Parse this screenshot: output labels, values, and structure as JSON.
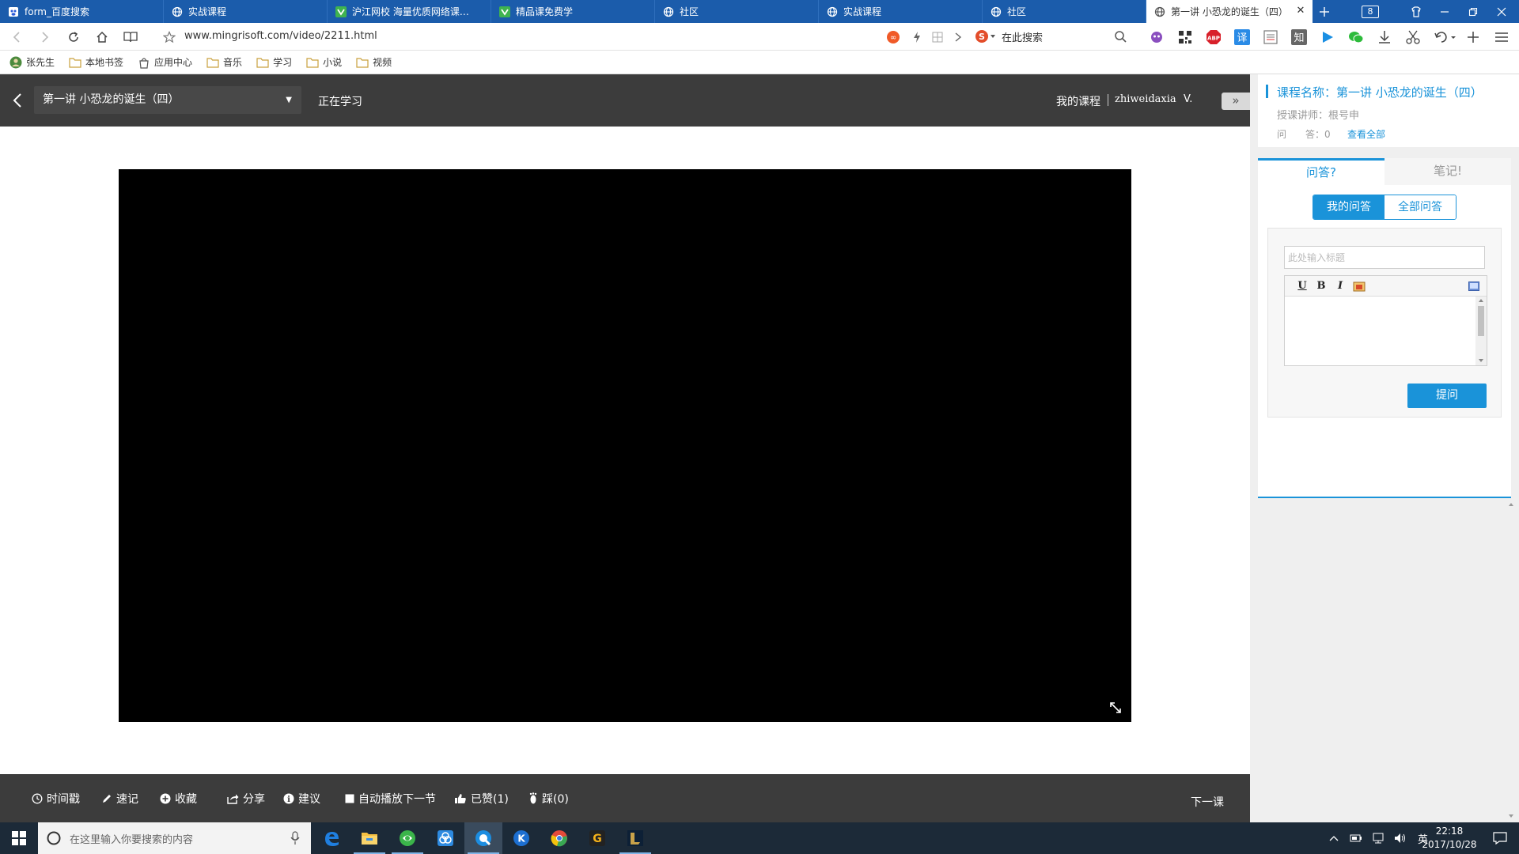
{
  "browser": {
    "tabs": [
      {
        "title": "form_百度搜索",
        "icon": "baidu-icon"
      },
      {
        "title": "实战课程",
        "icon": "globe-icon"
      },
      {
        "title": "沪江网校 海量优质网络课程在线学习",
        "icon": "hujiang-icon"
      },
      {
        "title": "精品课免费学",
        "icon": "hujiang-icon"
      },
      {
        "title": "社区",
        "icon": "globe-icon"
      },
      {
        "title": "实战课程",
        "icon": "globe-icon"
      },
      {
        "title": "社区",
        "icon": "globe-icon"
      },
      {
        "title": "第一讲 小恐龙的诞生（四）",
        "icon": "globe-icon",
        "active": true
      }
    ],
    "tab_count": "8",
    "url": "www.mingrisoft.com/video/2211.html",
    "search_placeholder": "在此搜索",
    "bookmarks": [
      {
        "label": "张先生",
        "icon": "user-avatar-icon"
      },
      {
        "label": "本地书签",
        "icon": "folder-icon"
      },
      {
        "label": "应用中心",
        "icon": "app-icon"
      },
      {
        "label": "音乐",
        "icon": "folder-icon"
      },
      {
        "label": "学习",
        "icon": "folder-icon"
      },
      {
        "label": "小说",
        "icon": "folder-icon"
      },
      {
        "label": "视频",
        "icon": "folder-icon"
      }
    ],
    "extensions": {
      "translate": "译",
      "zhihu": "知",
      "abp": "ABP"
    }
  },
  "page": {
    "lesson_select": "第一讲 小恐龙的诞生（四）",
    "status": "正在学习",
    "my_courses": "我的课程",
    "username": "zhiweidaxia",
    "vip_mark": "V."
  },
  "toolbar": {
    "timestamp": "时间戳",
    "note": "速记",
    "favorite": "收藏",
    "share": "分享",
    "suggest": "建议",
    "autoplay": "自动播放下一节",
    "liked": "已赞(1)",
    "dislike": "踩(0)",
    "next_lesson": "下一课"
  },
  "panel": {
    "course_name": "课程名称：第一讲 小恐龙的诞生（四）",
    "teacher": "授课讲师：根号申",
    "qa_count": "问　　答：0",
    "view_all": "查看全部",
    "tab_qa": "问答?",
    "tab_notes": "笔记!",
    "my_qa": "我的问答",
    "all_qa": "全部问答",
    "title_placeholder": "此处输入标题",
    "editor_underline": "U",
    "editor_bold": "B",
    "editor_italic": "I",
    "ask_button": "提问"
  },
  "taskbar": {
    "search_placeholder": "在这里输入你要搜索的内容",
    "ime": "英",
    "time": "22:18",
    "date": "2017/10/28"
  },
  "colors": {
    "tabbar": "#1b5cab",
    "header": "#3c3c3c",
    "accent": "#1a93d9",
    "taskbar": "#1c2a38"
  }
}
